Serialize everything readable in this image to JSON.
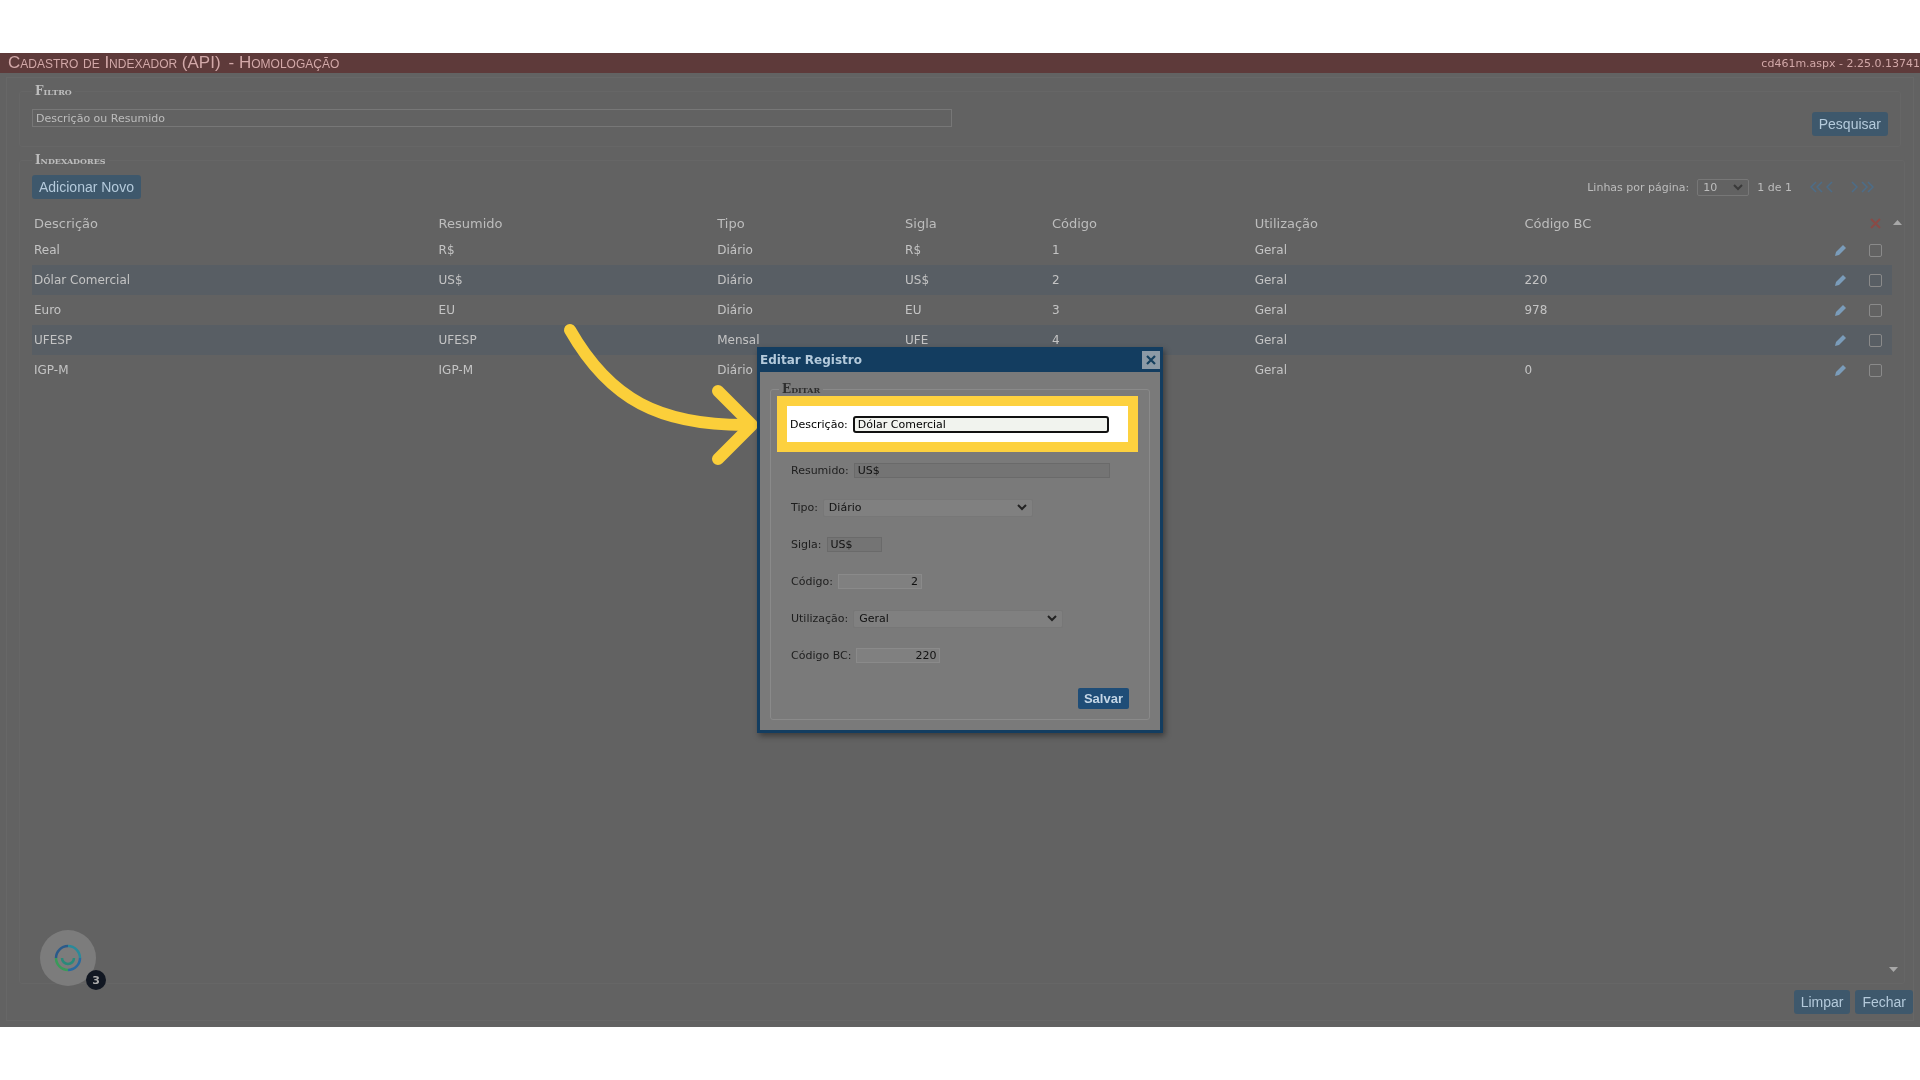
{
  "header": {
    "title": "Cadastro de Indexador (API)",
    "environment": "- Homologação",
    "version": "cd461m.aspx - 2.25.0.13741"
  },
  "filter": {
    "legend": "Filtro",
    "search": {
      "placeholder": "Descrição ou Resumido"
    },
    "button": "Pesquisar"
  },
  "indexadores": {
    "legend": "Indexadores",
    "add_button": "Adicionar Novo",
    "rows_per_page_label": "Linhas por página:",
    "rows_per_page": "10",
    "page_info": "1 de 1"
  },
  "table": {
    "columns": [
      "Descrição",
      "Resumido",
      "Tipo",
      "Sigla",
      "Código",
      "Utilização",
      "Código BC"
    ],
    "rows": [
      {
        "cells": [
          "Real",
          "R$",
          "Diário",
          "R$",
          "1",
          "Geral",
          ""
        ],
        "checked": false
      },
      {
        "cells": [
          "Dólar Comercial",
          "US$",
          "Diário",
          "US$",
          "2",
          "Geral",
          "220"
        ],
        "checked": false
      },
      {
        "cells": [
          "Euro",
          "EU",
          "Diário",
          "EU",
          "3",
          "Geral",
          "978"
        ],
        "checked": false
      },
      {
        "cells": [
          "UFESP",
          "UFESP",
          "Mensal",
          "UFE",
          "4",
          "Geral",
          ""
        ],
        "checked": false
      },
      {
        "cells": [
          "IGP-M",
          "IGP-M",
          "Diário",
          "",
          "",
          "Geral",
          "0"
        ],
        "checked": false
      }
    ]
  },
  "dialog": {
    "title": "Editar Registro",
    "legend": "Editar",
    "fields": [
      {
        "label": "Descrição:",
        "kind": "text",
        "value": "Dólar Comercial",
        "disabled": false,
        "highlighted": true
      },
      {
        "label": "Resumido:",
        "kind": "text",
        "value": "US$",
        "disabled": true,
        "highlighted": false
      },
      {
        "label": "Tipo:",
        "kind": "select",
        "value": "Diário",
        "disabled": false,
        "highlighted": false
      },
      {
        "label": "Sigla:",
        "kind": "text",
        "value": "US$",
        "disabled": true,
        "highlighted": false
      },
      {
        "label": "Código:",
        "kind": "number",
        "value": "2",
        "disabled": false,
        "highlighted": false
      },
      {
        "label": "Utilização:",
        "kind": "select",
        "value": "Geral",
        "disabled": false,
        "highlighted": false
      },
      {
        "label": "Código BC:",
        "kind": "number",
        "value": "220",
        "disabled": false,
        "highlighted": false
      }
    ],
    "save_button": "Salvar"
  },
  "chat": {
    "badge": "3"
  },
  "footer_buttons": [
    "Limpar",
    "Fechar"
  ]
}
